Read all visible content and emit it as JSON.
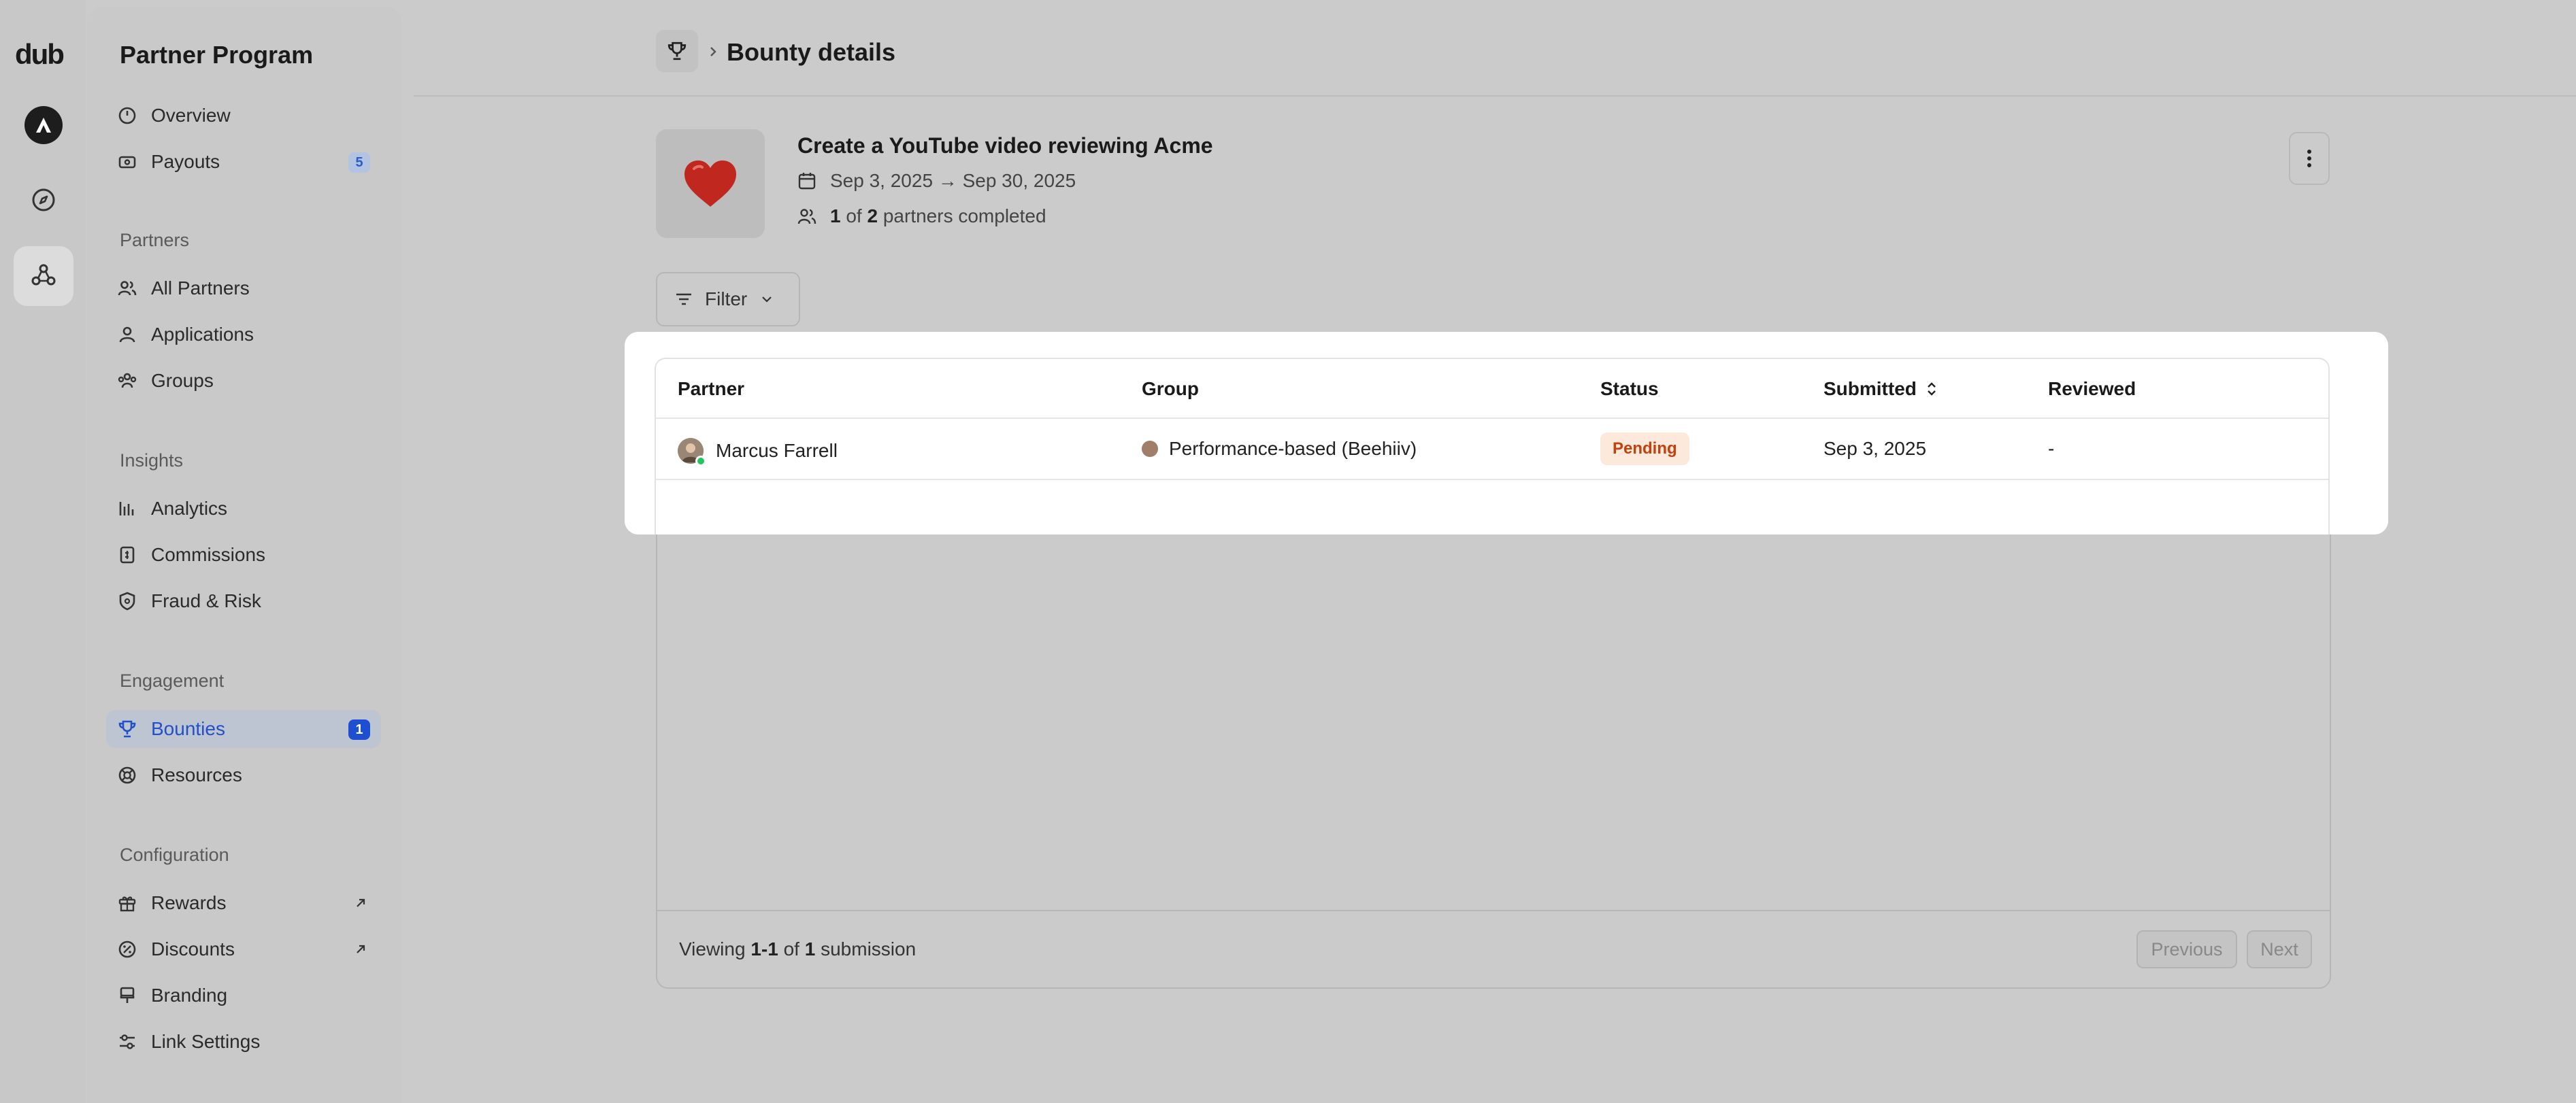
{
  "app": {
    "logo_text": "dub"
  },
  "sidebar": {
    "title": "Partner Program",
    "items": {
      "overview": "Overview",
      "payouts": "Payouts",
      "payouts_badge": "5",
      "all_partners": "All Partners",
      "applications": "Applications",
      "groups": "Groups",
      "analytics": "Analytics",
      "commissions": "Commissions",
      "fraud_risk": "Fraud & Risk",
      "bounties": "Bounties",
      "bounties_badge": "1",
      "resources": "Resources",
      "rewards": "Rewards",
      "discounts": "Discounts",
      "branding": "Branding",
      "link_settings": "Link Settings"
    },
    "sections": {
      "partners": "Partners",
      "insights": "Insights",
      "engagement": "Engagement",
      "configuration": "Configuration"
    }
  },
  "header": {
    "breadcrumb_title": "Bounty details"
  },
  "bounty": {
    "name": "Create a YouTube video reviewing Acme",
    "date_range": "Sep 3, 2025 → Sep 30, 2025",
    "completed_count": "1",
    "completed_of": "of",
    "total_partners": "2",
    "completed_suffix": "partners completed"
  },
  "filter": {
    "label": "Filter"
  },
  "table": {
    "columns": {
      "partner": "Partner",
      "group": "Group",
      "status": "Status",
      "submitted": "Submitted",
      "reviewed": "Reviewed"
    },
    "rows": [
      {
        "partner": "Marcus Farrell",
        "group": "Performance-based (Beehiiv)",
        "group_color": "#a07e6a",
        "status": "Pending",
        "submitted": "Sep 3, 2025",
        "reviewed": "-"
      }
    ]
  },
  "footer": {
    "viewing_prefix": "Viewing",
    "viewing_range": "1-1",
    "viewing_of": "of",
    "viewing_total": "1",
    "viewing_suffix": "submission",
    "previous_label": "Previous",
    "next_label": "Next"
  },
  "colors": {
    "accent": "#2250c9",
    "pending_bg": "#fde8dc",
    "pending_text": "#c2410c",
    "online": "#22c55e"
  }
}
